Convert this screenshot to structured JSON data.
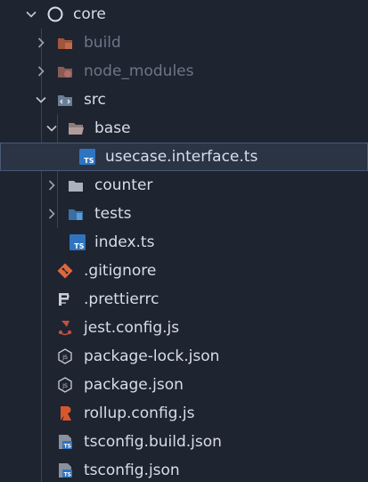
{
  "explorer": {
    "root": {
      "label": "core",
      "icon": "circle-outline-icon",
      "expanded": true
    },
    "items": [
      {
        "label": "build",
        "icon": "folder-build-icon",
        "kind": "folder",
        "expanded": false,
        "dimmed": true
      },
      {
        "label": "node_modules",
        "icon": "folder-node-icon",
        "kind": "folder",
        "expanded": false,
        "dimmed": true
      },
      {
        "label": "src",
        "icon": "folder-src-icon",
        "kind": "folder",
        "expanded": true
      },
      {
        "label": "base",
        "icon": "folder-open-icon",
        "kind": "folder",
        "expanded": true
      },
      {
        "label": "usecase.interface.ts",
        "icon": "typescript-icon",
        "kind": "file",
        "selected": true
      },
      {
        "label": "counter",
        "icon": "folder-icon",
        "kind": "folder",
        "expanded": false
      },
      {
        "label": "tests",
        "icon": "folder-test-icon",
        "kind": "folder",
        "expanded": false
      },
      {
        "label": "index.ts",
        "icon": "typescript-icon",
        "kind": "file"
      },
      {
        "label": ".gitignore",
        "icon": "git-icon",
        "kind": "file"
      },
      {
        "label": ".prettierrc",
        "icon": "prettier-icon",
        "kind": "file"
      },
      {
        "label": "jest.config.js",
        "icon": "jest-icon",
        "kind": "file"
      },
      {
        "label": "package-lock.json",
        "icon": "nodejs-icon",
        "kind": "file"
      },
      {
        "label": "package.json",
        "icon": "nodejs-icon",
        "kind": "file"
      },
      {
        "label": "rollup.config.js",
        "icon": "rollup-icon",
        "kind": "file"
      },
      {
        "label": "tsconfig.build.json",
        "icon": "tsconfig-icon",
        "kind": "file"
      },
      {
        "label": "tsconfig.json",
        "icon": "tsconfig-icon",
        "kind": "file"
      }
    ],
    "colors": {
      "background": "#1e2430",
      "text": "#d8dee9",
      "dimmed_text": "#6d7687",
      "selection": "#2a3445",
      "ts_blue": "#2f74c0",
      "git_orange": "#e0673a"
    }
  }
}
